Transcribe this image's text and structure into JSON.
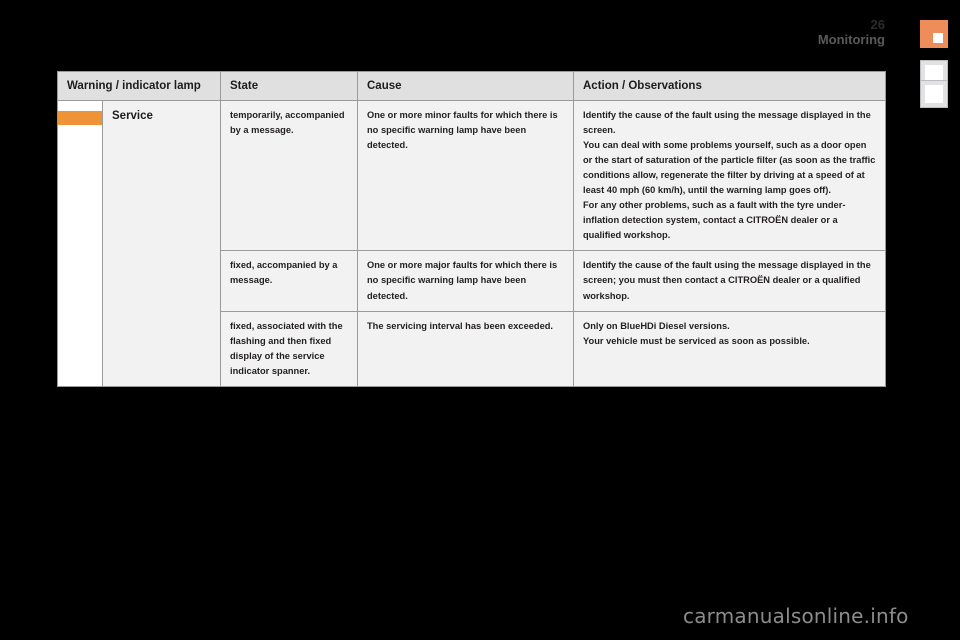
{
  "page": {
    "number": "26",
    "chapter": "Monitoring",
    "watermark": "carmanualsonline.info",
    "accent_color": "#ee8d5a",
    "lamp_color": "#ef9338",
    "table_bg": "#f2f2f2",
    "header_bg": "#e0e0e1"
  },
  "tabs": [
    {
      "name": "active-chapter-tab",
      "state": "active"
    },
    {
      "name": "chapter-tab-2",
      "state": "plain"
    },
    {
      "name": "chapter-tab-3",
      "state": "plain"
    }
  ],
  "table": {
    "headers": [
      "Warning / indicator lamp",
      "State",
      "Cause",
      "Action / Observations"
    ],
    "lamp_name": "Service",
    "rows": [
      {
        "state": "temporarily, accompanied by a message.",
        "cause": "One or more minor faults for which there is no specific warning lamp have been detected.",
        "action": [
          "Identify the cause of the fault using the message displayed in the screen.",
          "You can deal with some problems yourself, such as a door open or the start of saturation of the particle filter (as soon as the traffic conditions allow, regenerate the filter by driving at a speed of at least 40 mph (60 km/h), until the warning lamp goes off).",
          "For any other problems, such as a fault with the tyre under-inflation detection system, contact a CITROËN dealer or a qualified workshop."
        ]
      },
      {
        "state": "fixed, accompanied by a message.",
        "cause": "One or more major faults for which there is no specific warning lamp have been detected.",
        "action": [
          "Identify the cause of the fault using the message displayed in the screen; you must then contact a CITROËN dealer or a qualified workshop."
        ]
      },
      {
        "state": "fixed, associated with the flashing and then fixed display of the service indicator spanner.",
        "cause": "The servicing interval has been exceeded.",
        "action": [
          "Only on BlueHDi Diesel versions.",
          "Your vehicle must be serviced as soon as possible."
        ]
      }
    ]
  }
}
